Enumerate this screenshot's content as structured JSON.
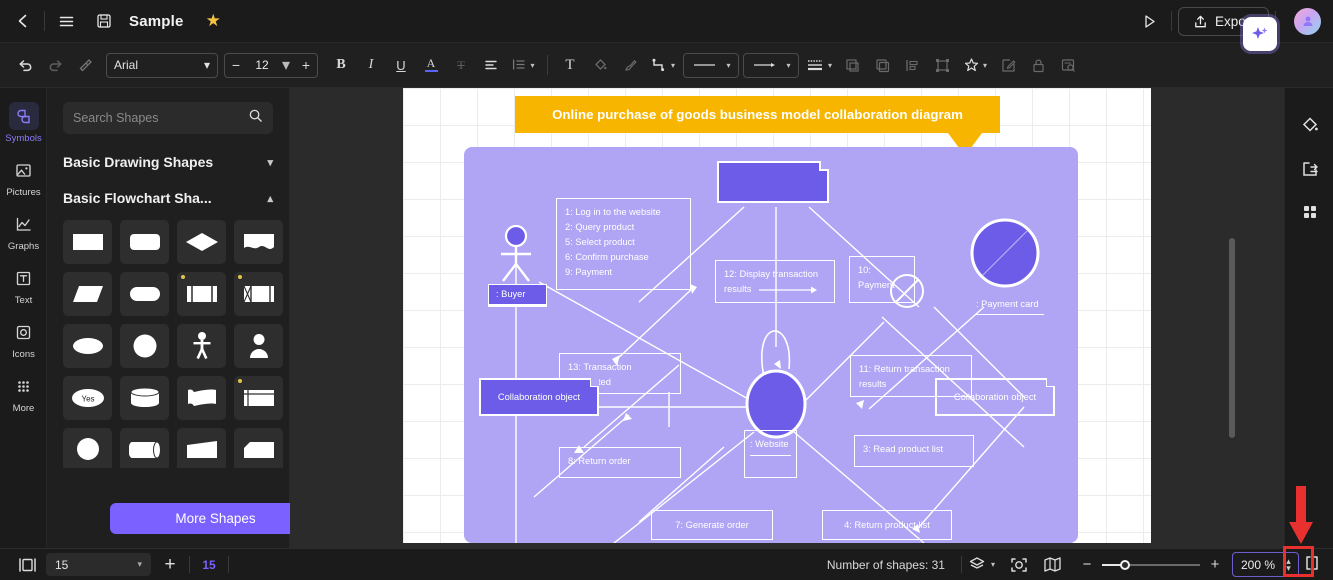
{
  "titlebar": {
    "back_icon": "chevron-left-icon",
    "menu_icon": "hamburger-menu-icon",
    "save_icon": "save-disk-icon",
    "title": "Sample",
    "favorite_icon": "star-icon",
    "present_icon": "play-triangle-icon",
    "export_label": "Export",
    "export_icon": "share-upload-icon",
    "avatar_icon": "user-avatar"
  },
  "toolbar": {
    "undo_icon": "undo-arrow-icon",
    "redo_icon": "redo-arrow-icon",
    "format_painter_icon": "format-painter-icon",
    "font_family": "Arial",
    "font_size": "12",
    "decrease_label": "−",
    "increase_label": "+",
    "bold_label": "B",
    "italic_label": "I",
    "underline_label": "U",
    "font_color_label": "A",
    "strikethrough_label": "T",
    "align_icon": "align-left-icon",
    "line_spacing_icon": "line-spacing-icon",
    "text_box_label": "T",
    "fill_icon": "paint-bucket-icon",
    "brush_icon": "brush-icon",
    "connector_icon": "connector-line-icon",
    "line_style_icon": "line-style-icon",
    "arrow_style_icon": "arrow-style-icon",
    "line_weight_icon": "line-weight-icon",
    "duplicate_icon": "duplicate-icon",
    "copy_icon": "copy-icon",
    "align_objects_icon": "align-objects-icon",
    "group_icon": "group-icon",
    "shape_effects_icon": "shape-effects-icon",
    "edit_icon": "edit-pencil-icon",
    "lock_icon": "lock-icon",
    "find_icon": "find-replace-icon"
  },
  "left_rail": {
    "items": [
      {
        "label": "Symbols",
        "icon": "symbols-icon",
        "active": true
      },
      {
        "label": "Pictures",
        "icon": "picture-icon",
        "active": false
      },
      {
        "label": "Graphs",
        "icon": "chart-line-icon",
        "active": false
      },
      {
        "label": "Text",
        "icon": "text-box-icon",
        "active": false
      },
      {
        "label": "Icons",
        "icon": "icons-icon",
        "active": false
      },
      {
        "label": "More",
        "icon": "more-dots-icon",
        "active": false
      }
    ]
  },
  "shapes_panel": {
    "search_placeholder": "Search Shapes",
    "search_value": "",
    "search_icon": "search-icon",
    "groups": [
      {
        "title": "Basic Drawing Shapes",
        "expanded": false,
        "chevron": "chevron-down-icon"
      },
      {
        "title": "Basic Flowchart Sha...",
        "expanded": true,
        "chevron": "chevron-up-icon"
      }
    ],
    "shapes": [
      {
        "name": "rectangle",
        "new": false
      },
      {
        "name": "rounded-rectangle",
        "new": false
      },
      {
        "name": "diamond",
        "new": false
      },
      {
        "name": "wave-document",
        "new": false
      },
      {
        "name": "parallelogram",
        "new": false
      },
      {
        "name": "stadium-terminator",
        "new": false
      },
      {
        "name": "predefined-process",
        "new": true
      },
      {
        "name": "internal-storage",
        "new": true
      },
      {
        "name": "ellipse",
        "new": false
      },
      {
        "name": "circle",
        "new": false
      },
      {
        "name": "actor-stick-figure",
        "new": false
      },
      {
        "name": "person-bust",
        "new": false
      },
      {
        "name": "decision-yes",
        "new": false,
        "text": "Yes"
      },
      {
        "name": "cylinder-database",
        "new": false
      },
      {
        "name": "document-curve",
        "new": false
      },
      {
        "name": "multi-document",
        "new": true
      },
      {
        "name": "circle-connector",
        "new": false
      },
      {
        "name": "direct-access-storage",
        "new": false
      },
      {
        "name": "trapezoid-slope",
        "new": false
      },
      {
        "name": "card-notched",
        "new": false
      }
    ],
    "more_shapes_label": "More Shapes"
  },
  "canvas": {
    "ai_icon": "ai-sparkle-icon",
    "banner_title": "Online purchase of goods business model collaboration diagram",
    "banner_color": "#f7b500",
    "frame_color": "#b0a4f5",
    "accent_color": "#6c5ce7",
    "nodes": [
      {
        "name": "top-object-node",
        "label": "",
        "type": "object-filled"
      },
      {
        "name": "buyer-actor",
        "label": ": Buyer",
        "type": "actor"
      },
      {
        "name": "payment-card-object",
        "label": ": Payment card",
        "type": "circle-object"
      },
      {
        "name": "website-object",
        "label": ": Website",
        "type": "box-object"
      },
      {
        "name": "collaboration-object-left",
        "label": "Collaboration object",
        "type": "object-filled"
      },
      {
        "name": "collaboration-object-right",
        "label": "Collaboration object",
        "type": "object-outline"
      },
      {
        "name": "center-circle-object",
        "label": "",
        "type": "circle-filled"
      }
    ],
    "messages": [
      {
        "id": "note-steps",
        "lines": [
          "1: Log in to the website",
          "2: Query product",
          "5: Select product",
          "6: Confirm purchase",
          "9: Payment"
        ]
      },
      {
        "id": "msg-12",
        "text": "12: Display transaction results"
      },
      {
        "id": "msg-10",
        "text": "10: Payment"
      },
      {
        "id": "msg-13",
        "text": "13: Transaction completed"
      },
      {
        "id": "msg-11",
        "text": "11: Return transaction results"
      },
      {
        "id": "msg-8",
        "text": "8: Return order"
      },
      {
        "id": "msg-3",
        "text": "3: Read product list"
      },
      {
        "id": "msg-7",
        "text": "7: Generate order"
      },
      {
        "id": "msg-4",
        "text": "4: Return product list"
      }
    ]
  },
  "right_rail": {
    "items": [
      {
        "name": "fill-style-icon",
        "label": "fill-style"
      },
      {
        "name": "panel-layout-icon",
        "label": "panel-layout"
      },
      {
        "name": "grid-apps-icon",
        "label": "grid-apps"
      }
    ]
  },
  "status": {
    "pages_icon": "pages-view-icon",
    "page_value": "15",
    "page_caret": "chevron-down-icon",
    "add_page_label": "+",
    "current_page": "15",
    "shape_count_label": "Number of shapes: 31",
    "layers_icon": "layers-icon",
    "focus_icon": "focus-mode-icon",
    "map_icon": "map-overview-icon",
    "zoom_out_label": "−",
    "zoom_in_label": "+",
    "zoom_value": "200 %",
    "stepper_up": "▲",
    "stepper_down": "▼",
    "fit_icon": "fit-to-screen-icon"
  },
  "annotation": {
    "arrow_color": "#e8312f",
    "highlight_color": "#e8312f",
    "target": "zoom-stepper"
  }
}
